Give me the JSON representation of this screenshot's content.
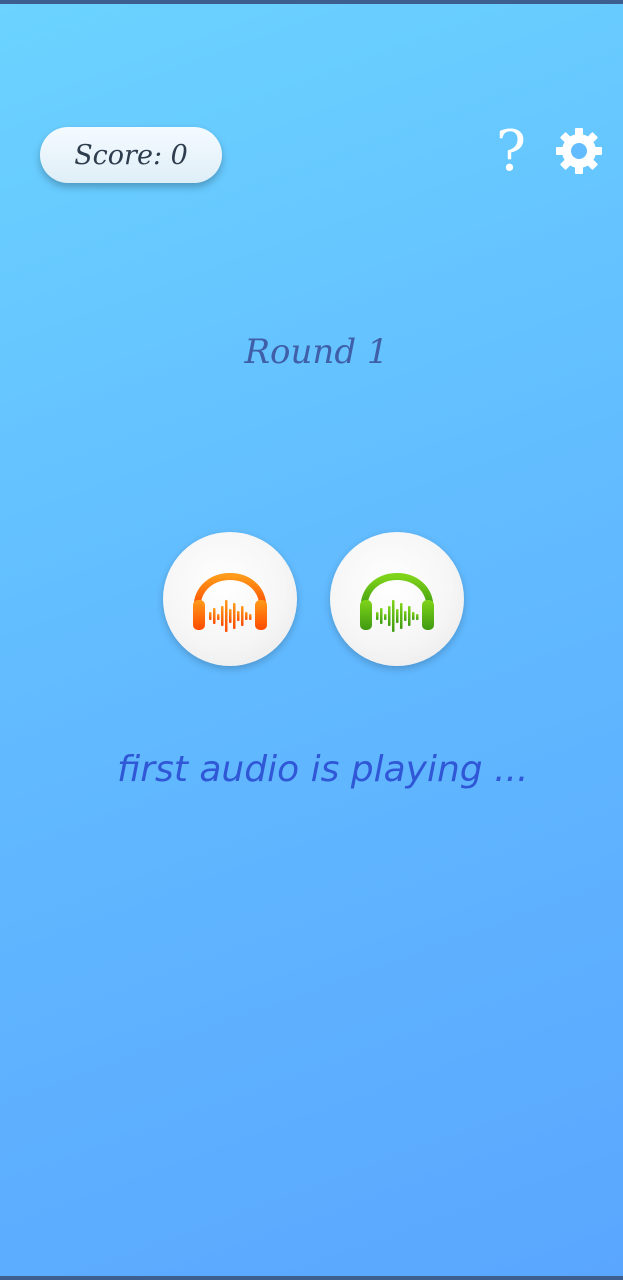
{
  "header": {
    "score_label": "Score: 0",
    "help_label": "?",
    "help_icon": "question-mark-icon",
    "settings_icon": "gear-icon"
  },
  "game": {
    "round_label": "Round 1",
    "status_text": "first audio is playing ..."
  },
  "audio_buttons": [
    {
      "icon": "headphones-icon",
      "color": "#ff6a00"
    },
    {
      "icon": "headphones-icon",
      "color": "#4caf00"
    }
  ],
  "colors": {
    "background_start": "#6bd3ff",
    "background_end": "#5aa6ff",
    "round_text": "#3f5fa8",
    "status_text": "#2f57d6"
  }
}
